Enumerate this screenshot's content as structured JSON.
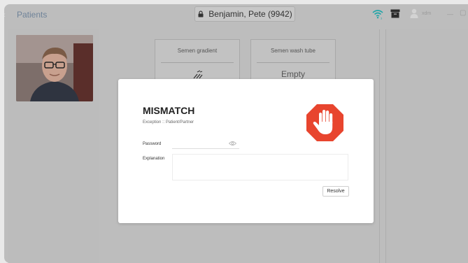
{
  "header": {
    "title": "Patients",
    "patient_name": "Benjamin, Pete (9942)",
    "user_name": "xdm"
  },
  "tubes": [
    {
      "label": "Semen gradient",
      "value": ""
    },
    {
      "label": "Semen wash tube",
      "value": "Empty"
    }
  ],
  "modal": {
    "title": "MISMATCH",
    "subtitle": "Exception :: Patient/Partner",
    "password_label": "Password",
    "password_value": "",
    "explanation_label": "Explanation",
    "explanation_value": "",
    "resolve_label": "Resolve",
    "icon": "stop-hand-icon"
  },
  "colors": {
    "stop_red": "#e8452e",
    "title_blue": "#6f8399",
    "wifi_teal": "#23a5a8"
  }
}
